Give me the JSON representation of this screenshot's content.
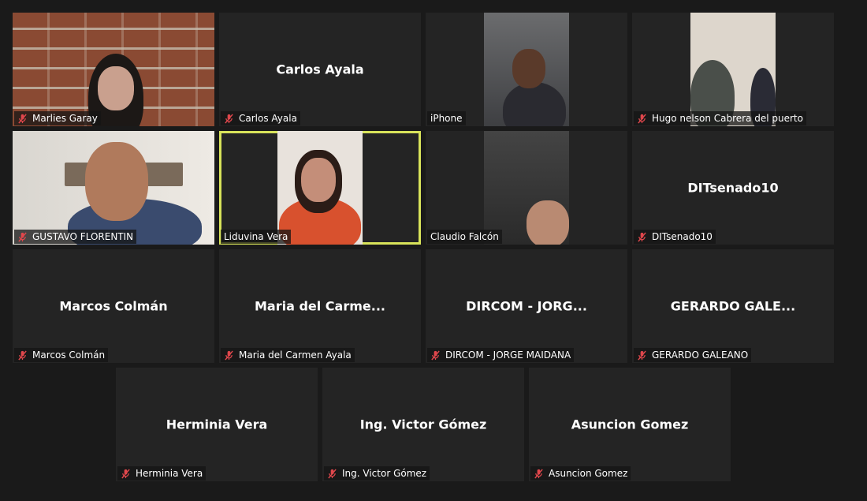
{
  "tiles": {
    "t1": {
      "label": "Marlies Garay",
      "muted": true
    },
    "t2": {
      "display_name": "Carlos Ayala",
      "label": "Carlos Ayala",
      "muted": true
    },
    "t3": {
      "label": "iPhone",
      "muted": false
    },
    "t4": {
      "label": "Hugo nelson Cabrera del puerto",
      "muted": true
    },
    "t5": {
      "label": "GUSTAVO FLORENTIN",
      "muted": true
    },
    "t6": {
      "label": "Liduvina Vera",
      "muted": false,
      "active_speaker": true
    },
    "t7": {
      "label": "Claudio Falcón",
      "muted": false
    },
    "t8": {
      "display_name": "DITsenado10",
      "label": "DITsenado10",
      "muted": true
    },
    "t9": {
      "display_name": "Marcos Colmán",
      "label": "Marcos Colmán",
      "muted": true
    },
    "t10": {
      "display_name": "Maria del Carme...",
      "label": "Maria del Carmen Ayala",
      "muted": true
    },
    "t11": {
      "display_name": "DIRCOM - JORG...",
      "label": "DIRCOM - JORGE MAIDANA",
      "muted": true
    },
    "t12": {
      "display_name": "GERARDO GALE...",
      "label": "GERARDO GALEANO",
      "muted": true
    },
    "t13": {
      "display_name": "Herminia Vera",
      "label": "Herminia Vera",
      "muted": true
    },
    "t14": {
      "display_name": "Ing. Victor Gómez",
      "label": "Ing. Victor Gómez",
      "muted": true
    },
    "t15": {
      "display_name": "Asuncion Gomez",
      "label": "Asuncion Gomez",
      "muted": true
    }
  },
  "colors": {
    "background": "#1a1a1a",
    "tile": "#242424",
    "active_border": "#d8e35a",
    "mute_icon": "#e0474c"
  },
  "icons": {
    "mute": "microphone-muted-icon"
  }
}
